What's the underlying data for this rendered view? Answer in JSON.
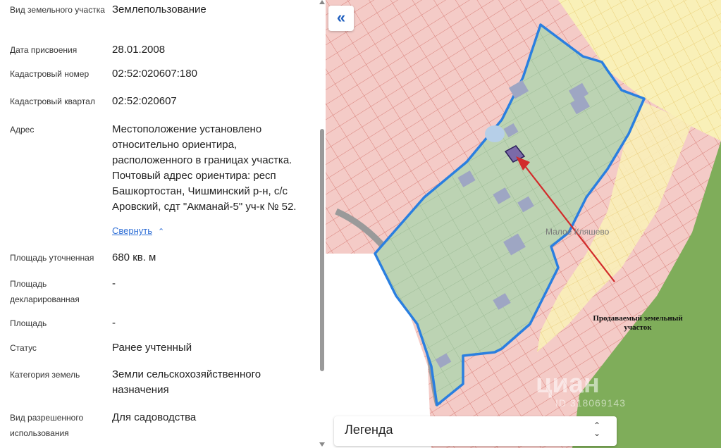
{
  "details": [
    {
      "label": "Вид земельного участка",
      "value": "Землепользование"
    },
    {
      "label": "Дата присвоения",
      "value": "28.01.2008"
    },
    {
      "label": "Кадастровый номер",
      "value": "02:52:020607:180"
    },
    {
      "label": "Кадастровый квартал",
      "value": "02:52:020607"
    },
    {
      "label": "Адрес",
      "value": "Местоположение установлено относительно ориентира, расположенного в границах участка. Почтовый адрес ориентира: респ Башкортостан, Чишминский р-н, с/с Аровский, сдт \"Акманай-5\" уч-к № 52."
    },
    {
      "label": "Площадь уточненная",
      "value": "680 кв. м"
    },
    {
      "label": "Площадь декларированная",
      "value": "-"
    },
    {
      "label": "Площадь",
      "value": "-"
    },
    {
      "label": "Статус",
      "value": "Ранее учтенный"
    },
    {
      "label": "Категория земель",
      "value": "Земли сельскохозяйственного назначения"
    },
    {
      "label": "Вид разрешенного использования",
      "value": "Для садоводства"
    }
  ],
  "address_collapse_label": "Свернуть",
  "map": {
    "collapse_icon": "«",
    "legend_label": "Легенда",
    "place_name": "Малое Кляшево",
    "annotation": "Продаваемый земельный участок",
    "watermark": "циан",
    "watermark_id": "ID 318069143",
    "colors": {
      "parcel_fill": "#b9d2b0",
      "boundary": "#2a7fe0",
      "arrow": "#d22b2b",
      "parcels": "#f2c6c2"
    }
  }
}
